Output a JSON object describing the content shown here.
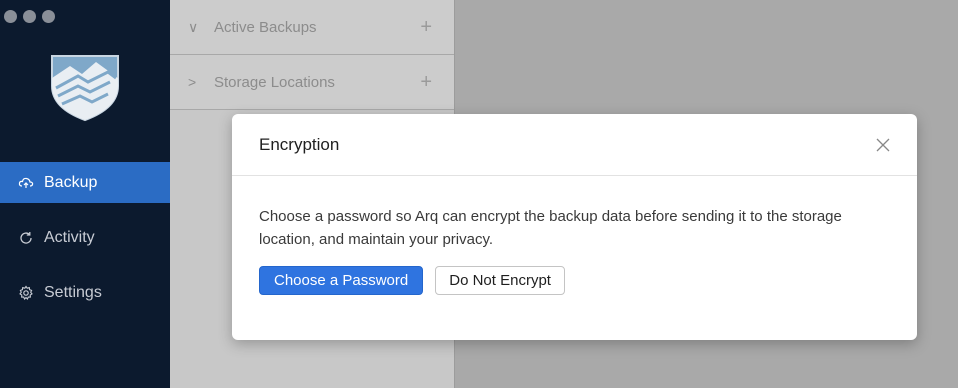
{
  "sidebar": {
    "items": [
      {
        "label": "Backup",
        "icon": "cloud-upload-icon",
        "active": true
      },
      {
        "label": "Activity",
        "icon": "refresh-icon",
        "active": false
      },
      {
        "label": "Settings",
        "icon": "gear-icon",
        "active": false
      }
    ]
  },
  "list": {
    "rows": [
      {
        "label": "Active Backups",
        "chevron": "chevron-down-icon",
        "action": "plus-icon"
      },
      {
        "label": "Storage Locations",
        "chevron": "chevron-right-icon",
        "action": "plus-icon"
      }
    ]
  },
  "modal": {
    "title": "Encryption",
    "message": "Choose a password so Arq can encrypt the backup data before sending it to the storage location, and maintain your privacy.",
    "primary_label": "Choose a Password",
    "secondary_label": "Do Not Encrypt"
  },
  "colors": {
    "sidebar_bg": "#0c1a2e",
    "accent": "#2b6cc4",
    "primary_button": "#2f74e0"
  }
}
